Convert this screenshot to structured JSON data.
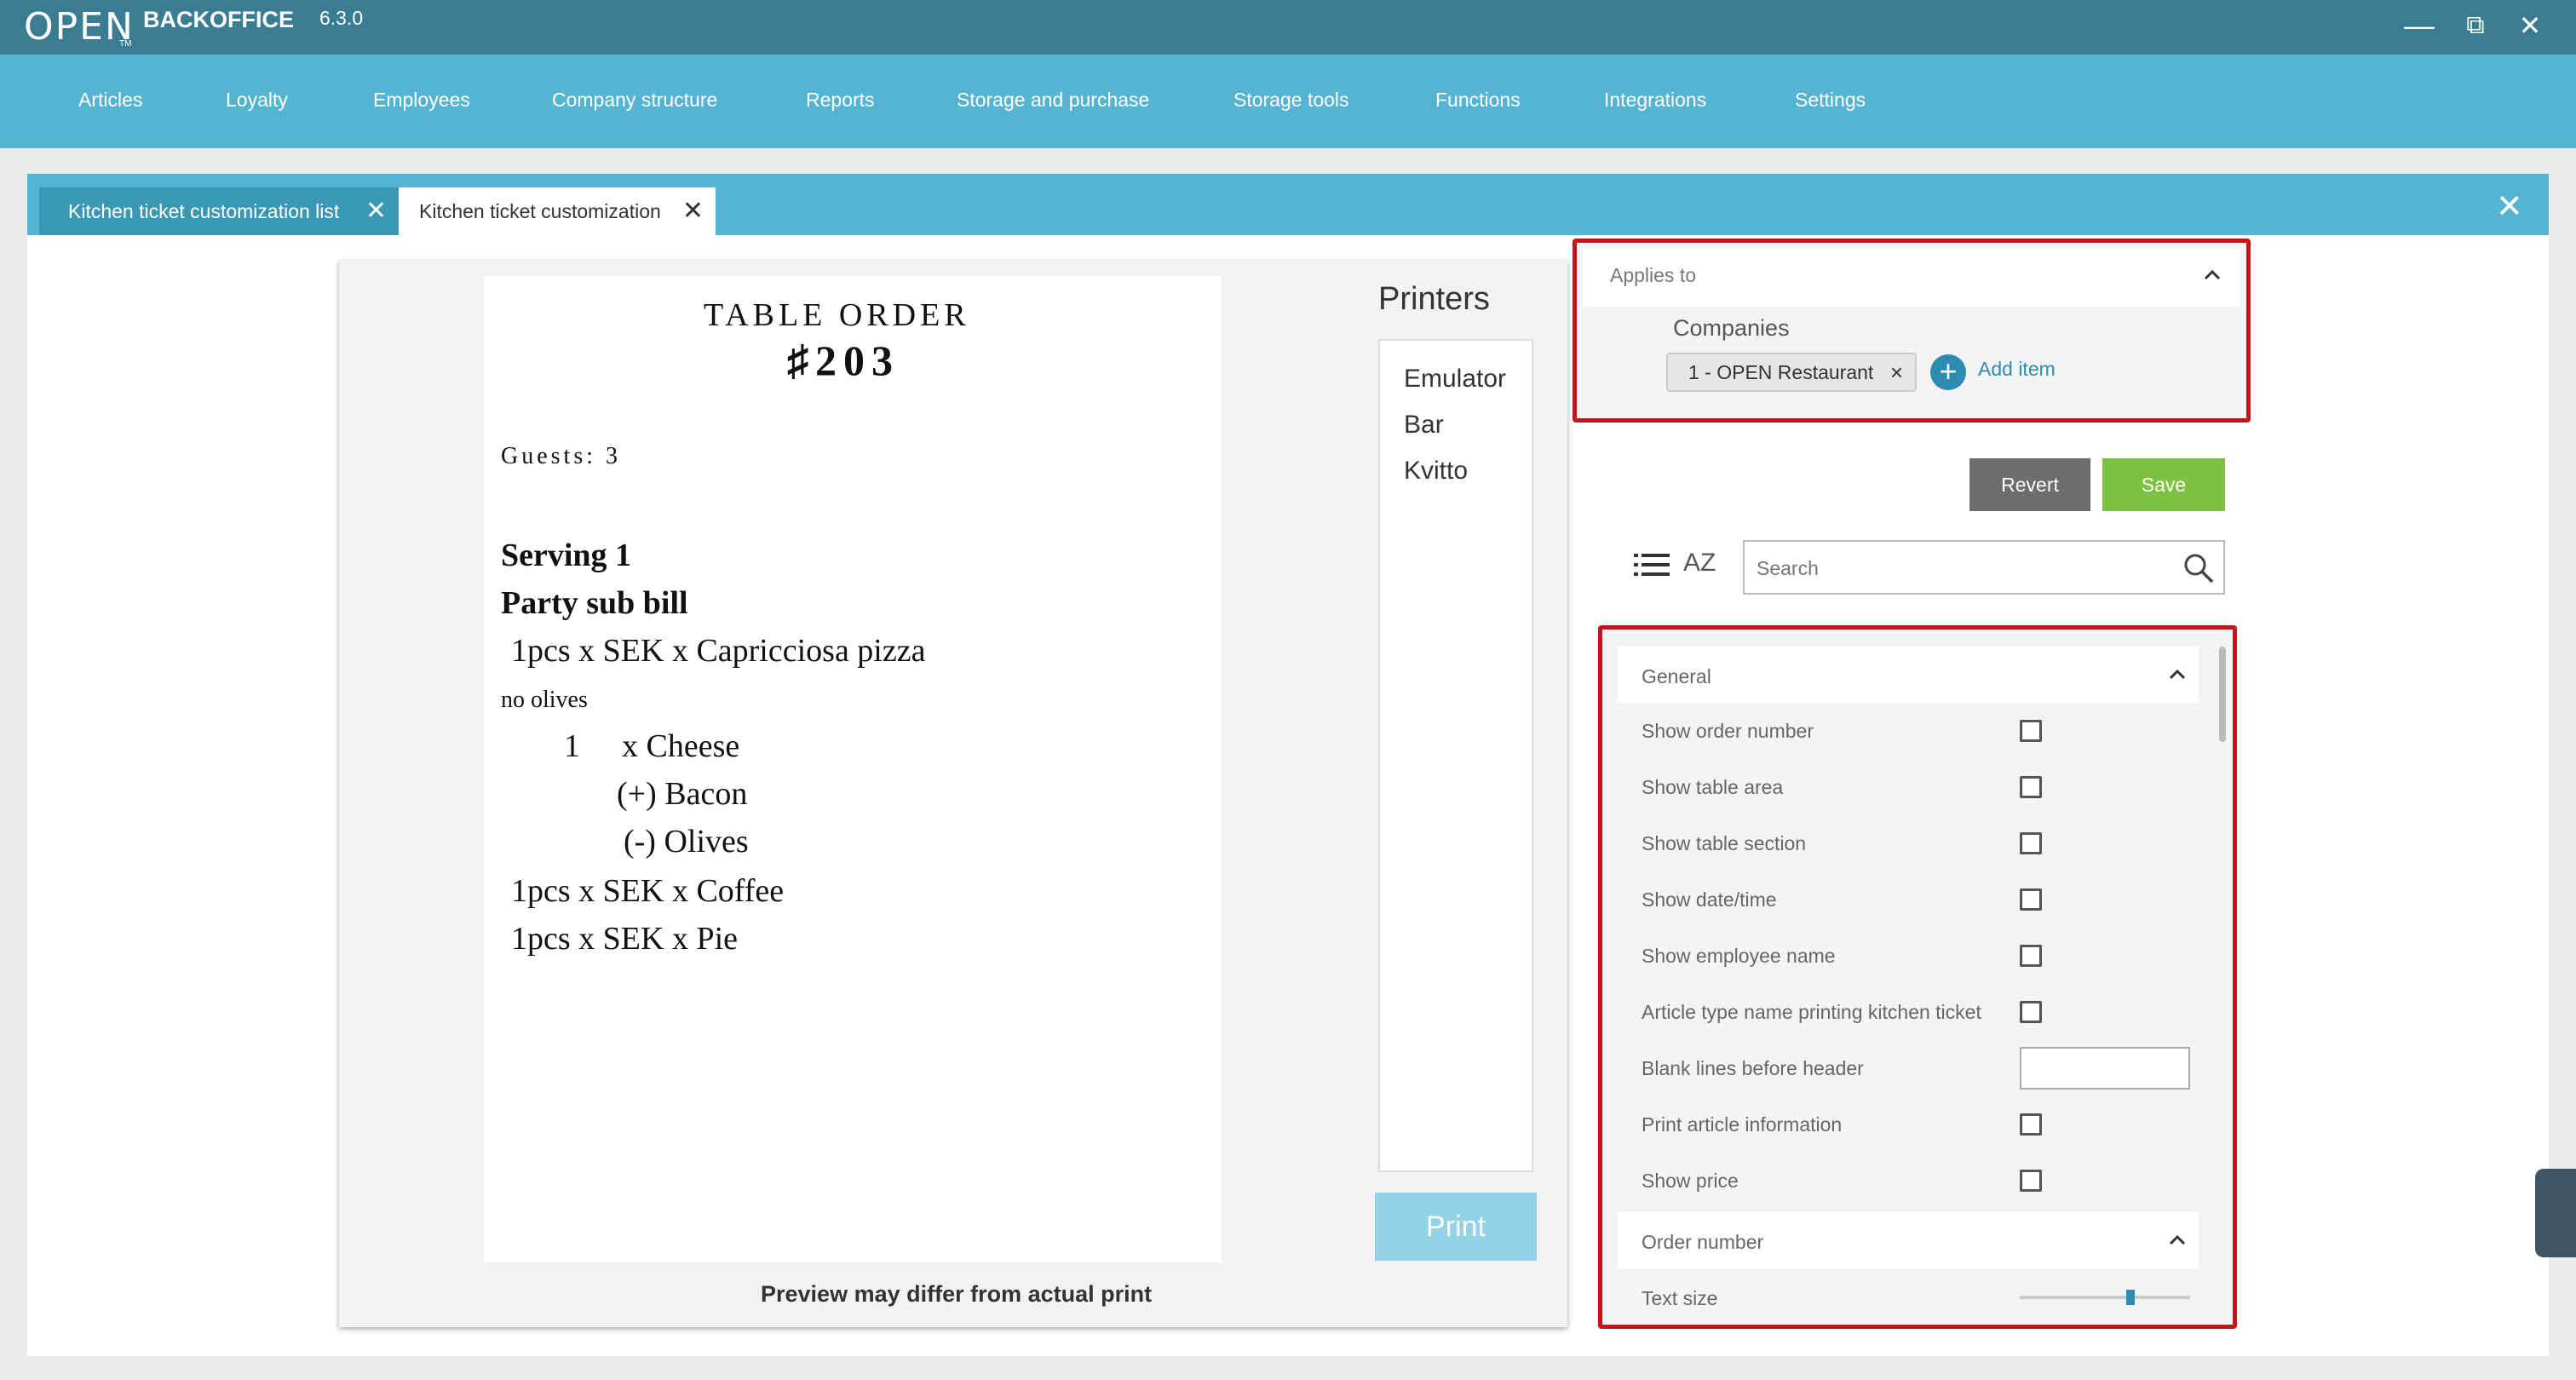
{
  "app": {
    "logo": "OPEN",
    "logo_tm": "TM",
    "name": "BACKOFFICE",
    "version": "6.3.0"
  },
  "window_controls": {
    "minimize": "—",
    "restore": "⧉",
    "close": "✕"
  },
  "nav": [
    "Articles",
    "Loyalty",
    "Employees",
    "Company structure",
    "Reports",
    "Storage and purchase",
    "Storage tools",
    "Functions",
    "Integrations",
    "Settings"
  ],
  "tabs": [
    {
      "label": "Kitchen ticket customization list",
      "close": "✕"
    },
    {
      "label": "Kitchen ticket customization",
      "close": "✕"
    }
  ],
  "tabs_close_all": "✕",
  "ticket": {
    "title": "TABLE ORDER",
    "number": "♯203",
    "guests": "Guests: 3",
    "serving": "Serving 1",
    "party": "Party sub bill",
    "line1": "1pcs x SEK x Capricciosa pizza",
    "note": "no olives",
    "sub1_qty": "1",
    "sub1": "x Cheese",
    "mod1": "(+) Bacon",
    "mod2": "(-) Olives",
    "line2": "1pcs x SEK x Coffee",
    "line3": "1pcs x SEK x Pie"
  },
  "printers": {
    "title": "Printers",
    "items": [
      "Emulator",
      "Bar",
      "Kvitto"
    ],
    "print_button": "Print"
  },
  "preview_note": "Preview may differ from actual print",
  "applies_to": {
    "title": "Applies to",
    "companies_label": "Companies",
    "chip": "1 - OPEN Restaurant",
    "chip_remove": "×",
    "add_icon": "+",
    "add_label": "Add item"
  },
  "buttons": {
    "revert": "Revert",
    "save": "Save"
  },
  "sort_icon": "AZ",
  "search": {
    "placeholder": "Search"
  },
  "general": {
    "title": "General",
    "rows": [
      "Show order number",
      "Show table area",
      "Show table section",
      "Show date/time",
      "Show employee name",
      "Article type name printing kitchen ticket",
      "Blank lines before header",
      "Print article information",
      "Show price"
    ]
  },
  "order_number": {
    "title": "Order number",
    "text_size_label": "Text size",
    "text_size_level": 0.65
  },
  "colors": {
    "titlebar": "#3a7d93",
    "navbar": "#55b4d2",
    "highlight": "#c4151c",
    "save": "#7fc243",
    "revert": "#6d6d6d",
    "link": "#2d8bb1"
  }
}
